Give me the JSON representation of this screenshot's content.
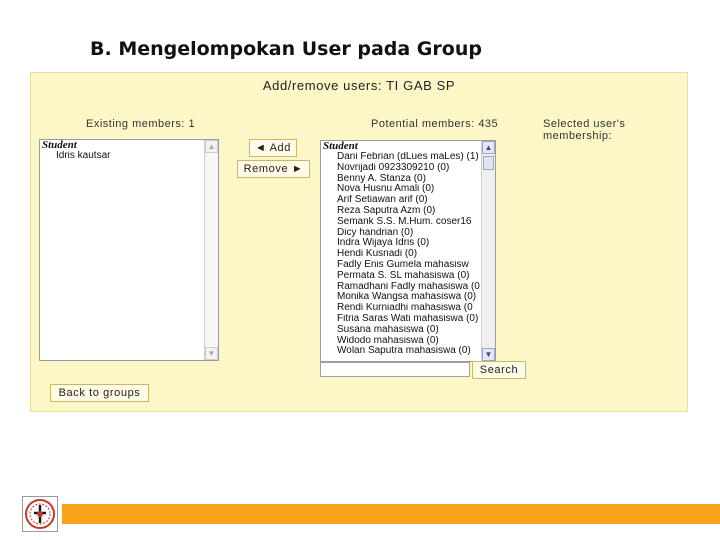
{
  "slide": {
    "title": "B. Mengelompokan User pada Group"
  },
  "panel": {
    "heading": "Add/remove users: TI GAB SP",
    "existing_label": "Existing members: 1",
    "potential_label": "Potential members: 435",
    "selected_label": "Selected user's membership:"
  },
  "existing_list": {
    "group": "Student",
    "items": [
      "Idris kautsar"
    ]
  },
  "potential_list": {
    "group": "Student",
    "items": [
      "Dani Febrian (dLues maLes) (1)",
      "Novrijadi 0923309210 (0)",
      "Benny A. Stanza (0)",
      "Nova Husnu Amali (0)",
      "Arif Setiawan arif (0)",
      "Reza Saputra Azm (0)",
      "Semank S.S. M.Hum. coser16",
      "Dicy handrian (0)",
      "Indra Wijaya Idris (0)",
      "Hendi Kusnadi (0)",
      "Fadly Enis Gumela mahasisw",
      "Permata S. SL mahasiswa (0)",
      "Ramadhani Fadly mahasiswa (0",
      "Monika Wangsa mahasiswa (0)",
      "Rendi Kurniadhi mahasiswa (0",
      "Fitria Saras Wati mahasiswa (0)",
      "Susana mahasiswa (0)",
      "Widodo mahasiswa (0)",
      "Wolan Saputra mahasiswa (0)"
    ]
  },
  "buttons": {
    "add": "◄ Add",
    "remove": "Remove ►",
    "search": "Search",
    "back": "Back to groups"
  },
  "search": {
    "value": ""
  },
  "icons": {
    "scroll_up": "▲",
    "scroll_down": "▼"
  },
  "colors": {
    "panel_bg": "#fdf7c8",
    "footer_bar": "#f6a31b"
  }
}
